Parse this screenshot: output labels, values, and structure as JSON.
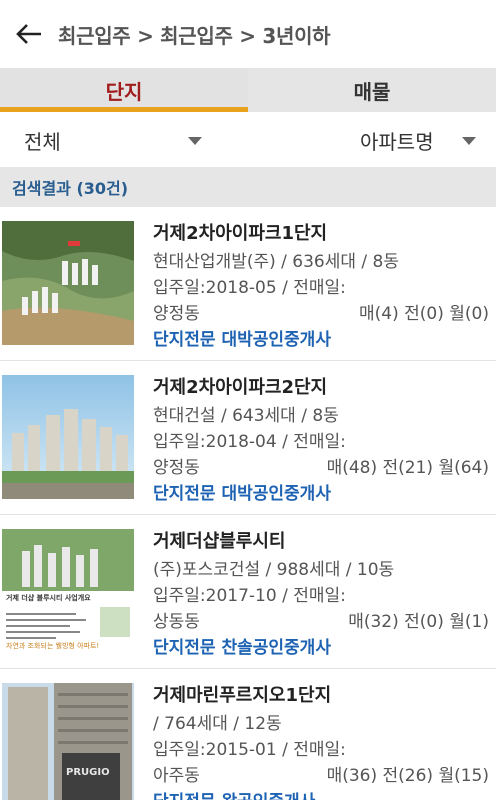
{
  "header": {
    "breadcrumb": "최근입주 > 최근입주 > 3년이하"
  },
  "tabs": [
    {
      "label": "단지",
      "active": true
    },
    {
      "label": "매물",
      "active": false
    }
  ],
  "filters": {
    "region": "전체",
    "sort": "아파트명"
  },
  "result": {
    "label": "검색결과 (30건)"
  },
  "items": [
    {
      "name": "거제2차아이파크1단지",
      "builder": "현대산업개발(주) / 636세대 / 8동",
      "move_in": "입주일:2018-05 / 전매일:",
      "dong": "양정동",
      "counts": "매(4) 전(0) 월(0)",
      "agent": "단지전문 대박공인중개사"
    },
    {
      "name": "거제2차아이파크2단지",
      "builder": "현대건설 / 643세대 / 8동",
      "move_in": "입주일:2018-04 / 전매일:",
      "dong": "양정동",
      "counts": "매(48) 전(21) 월(64)",
      "agent": "단지전문 대박공인중개사"
    },
    {
      "name": "거제더샵블루시티",
      "builder": "(주)포스코건설 / 988세대 / 10동",
      "move_in": "입주일:2017-10 / 전매일:",
      "dong": "상동동",
      "counts": "매(32) 전(0) 월(1)",
      "agent": "단지전문 찬솔공인중개사"
    },
    {
      "name": "거제마린푸르지오1단지",
      "builder": " / 764세대 / 12동",
      "move_in": "입주일:2015-01 / 전매일:",
      "dong": "아주동",
      "counts": "매(36) 전(26) 월(15)",
      "agent": "단지전문 왕공인중개사"
    }
  ],
  "thumb3": {
    "title": "거제 더샵 블루시티 사업개요",
    "slogan": "자연과 조화되는 웰빙형 아파트!",
    "sign": "PRUGIO"
  },
  "colors": {
    "tab_active_text": "#a11c1c",
    "tab_underline": "#e9a21b",
    "result_text": "#2a5d8f",
    "agent_text": "#1e63b3"
  }
}
